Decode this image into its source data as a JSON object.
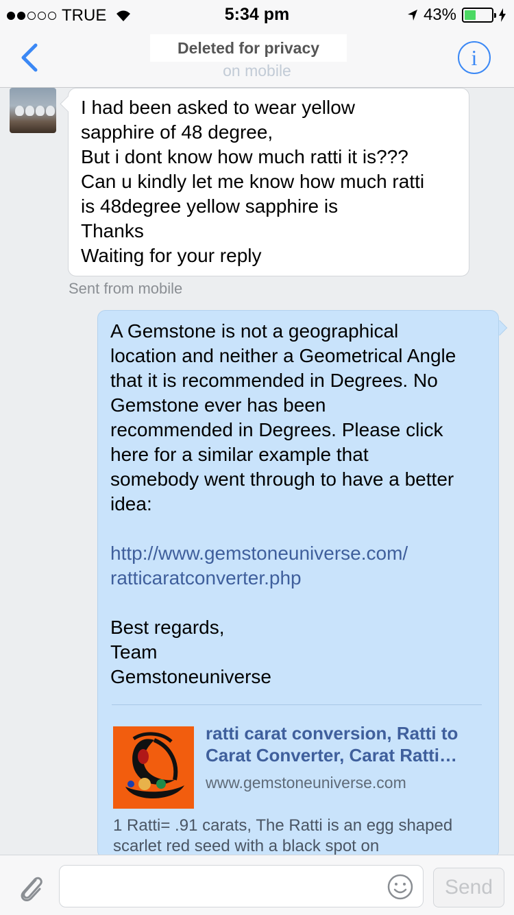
{
  "status_bar": {
    "carrier": "TRUE",
    "time": "5:34 pm",
    "battery": "43%",
    "battery_level": 0.43,
    "signal_bars": 2
  },
  "header": {
    "title": "Deleted for privacy",
    "subtitle": "on mobile"
  },
  "incoming_message": {
    "lines": [
      "I had been asked to wear yellow",
      "sapphire of 48 degree,",
      "But i dont know how much ratti it is???",
      "Can u kindly let me know how much ratti",
      "is 48degree yellow sapphire is",
      "Thanks",
      "Waiting for your reply"
    ],
    "meta": "Sent from mobile"
  },
  "outgoing_message": {
    "body_lines": [
      "A Gemstone is not a geographical",
      "location and neither a Geometrical Angle",
      "that it is recommended in Degrees. No",
      "Gemstone ever has been",
      "recommended in Degrees. Please click",
      "here for a similar example that",
      "somebody went through to have a better",
      "idea:"
    ],
    "link_lines": [
      "http://www.gemstoneuniverse.com/",
      "ratticaratconverter.php"
    ],
    "signature_lines": [
      "Best regards,",
      "Team",
      "Gemstoneuniverse"
    ],
    "preview": {
      "title": "ratti carat conversion, Ratti to Carat Converter, Carat Ratti…",
      "url": "www.gemstoneuniverse.com",
      "description": "1 Ratti= .91 carats, The Ratti is an egg shaped scarlet red seed with a black spot on"
    }
  },
  "composer": {
    "send_label": "Send"
  },
  "colors": {
    "accent": "#3b88f5",
    "outgoing_bubble": "#c9e3fb",
    "link": "#3f5f9c",
    "battery": "#4cd964"
  }
}
